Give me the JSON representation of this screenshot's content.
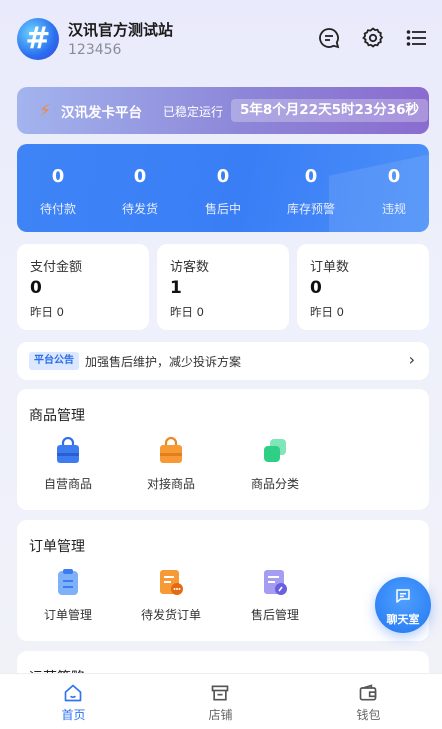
{
  "header": {
    "avatar_icon": "hash-logo-icon",
    "shop_name": "汉讯官方测试站",
    "shop_id": "123456",
    "icons": [
      "chat-bubble-icon",
      "gear-icon",
      "menu-icon"
    ]
  },
  "banner": {
    "icon": "bolt-icon",
    "platform_name": "汉讯发卡平台",
    "status": "已稳定运行",
    "uptime": "5年8个月22天5时23分36秒"
  },
  "order_stats": [
    {
      "value": "0",
      "label": "待付款"
    },
    {
      "value": "0",
      "label": "待发货"
    },
    {
      "value": "0",
      "label": "售后中"
    },
    {
      "value": "0",
      "label": "库存预警"
    },
    {
      "value": "0",
      "label": "违规"
    }
  ],
  "metrics": [
    {
      "title": "支付金额",
      "value": "0",
      "yesterday": "昨日 0"
    },
    {
      "title": "访客数",
      "value": "1",
      "yesterday": "昨日 0"
    },
    {
      "title": "订单数",
      "value": "0",
      "yesterday": "昨日 0"
    }
  ],
  "notice": {
    "tag": "平台公告",
    "text": "加强售后维护，减少投诉方案"
  },
  "goods_section": {
    "title": "商品管理",
    "items": [
      {
        "label": "自营商品",
        "icon": "shopping-bag-icon"
      },
      {
        "label": "对接商品",
        "icon": "shopping-bag-orange-icon"
      },
      {
        "label": "商品分类",
        "icon": "category-squares-icon"
      }
    ]
  },
  "orders_section": {
    "title": "订单管理",
    "items": [
      {
        "label": "订单管理",
        "icon": "clipboard-icon"
      },
      {
        "label": "待发货订单",
        "icon": "pending-document-icon"
      },
      {
        "label": "售后管理",
        "icon": "aftersale-document-icon"
      }
    ]
  },
  "partial_section_title": "运营策略",
  "chat_button": {
    "label": "聊天室",
    "icon": "chat-icon"
  },
  "tabs": [
    {
      "label": "首页",
      "icon": "home-icon",
      "active": true
    },
    {
      "label": "店铺",
      "icon": "store-icon",
      "active": false
    },
    {
      "label": "钱包",
      "icon": "wallet-icon",
      "active": false
    }
  ],
  "colors": {
    "primary": "#3a7ef6",
    "accent_orange": "#f08a3a",
    "banner_purple": "#8a6ccf",
    "active_tab": "#2f74f0"
  }
}
